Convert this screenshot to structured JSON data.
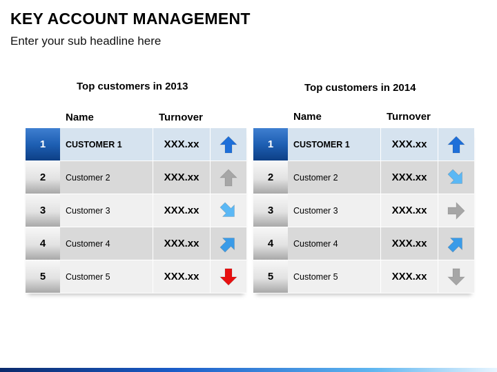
{
  "page": {
    "title": "KEY ACCOUNT MANAGEMENT",
    "subtitle": "Enter your sub headline here"
  },
  "tables": [
    {
      "title": "Top customers in 2013",
      "col_name": "Name",
      "col_turnover": "Turnover",
      "rows": [
        {
          "rank": "1",
          "name": "CUSTOMER 1",
          "value": "XXX.xx",
          "icon": "arrow-up-icon",
          "color": "#1e6fd9"
        },
        {
          "rank": "2",
          "name": "Customer 2",
          "value": "XXX.xx",
          "icon": "arrow-up-icon",
          "color": "#a6a6a6"
        },
        {
          "rank": "3",
          "name": "Customer 3",
          "value": "XXX.xx",
          "icon": "arrow-down-right-icon",
          "color": "#5bb8f5"
        },
        {
          "rank": "4",
          "name": "Customer 4",
          "value": "XXX.xx",
          "icon": "arrow-up-right-icon",
          "color": "#3a9be8"
        },
        {
          "rank": "5",
          "name": "Customer 5",
          "value": "XXX.xx",
          "icon": "arrow-down-icon",
          "color": "#e81010"
        }
      ]
    },
    {
      "title": "Top customers in 2014",
      "col_name": "Name",
      "col_turnover": "Turnover",
      "rows": [
        {
          "rank": "1",
          "name": "CUSTOMER 1",
          "value": "XXX.xx",
          "icon": "arrow-up-icon",
          "color": "#1e6fd9"
        },
        {
          "rank": "2",
          "name": "Customer 2",
          "value": "XXX.xx",
          "icon": "arrow-down-right-icon",
          "color": "#5bb8f5"
        },
        {
          "rank": "3",
          "name": "Customer 3",
          "value": "XXX.xx",
          "icon": "arrow-right-icon",
          "color": "#a6a6a6"
        },
        {
          "rank": "4",
          "name": "Customer 4",
          "value": "XXX.xx",
          "icon": "arrow-up-right-icon",
          "color": "#3a9be8"
        },
        {
          "rank": "5",
          "name": "Customer 5",
          "value": "XXX.xx",
          "icon": "arrow-down-icon",
          "color": "#a6a6a6"
        }
      ]
    }
  ]
}
